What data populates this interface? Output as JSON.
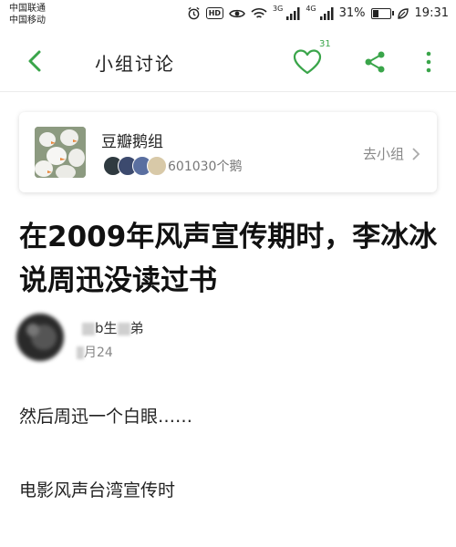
{
  "status_bar": {
    "carrier_1": "中国联通",
    "carrier_2": "中国移动",
    "network_labels": [
      "3G",
      "4G"
    ],
    "battery_text": "31%",
    "battery_level_percent": 31,
    "time": "19:31",
    "hd_label": "HD",
    "icons": [
      "alarm-icon",
      "hd-icon",
      "eye-icon",
      "wifi-icon",
      "signal-icon",
      "battery-icon",
      "leaf-icon"
    ]
  },
  "header": {
    "title": "小组讨论",
    "like_count": "31",
    "icons": [
      "back-icon",
      "heart-icon",
      "share-icon",
      "more-icon"
    ]
  },
  "group_card": {
    "name": "豆瓣鹅组",
    "member_count": "601030个鹅",
    "goto_label": "去小组"
  },
  "post": {
    "title": "在2009年风声宣传期时，李冰冰说周迅没读过书",
    "author_name_parts": [
      "b生",
      "弟"
    ],
    "date_visible": "月24",
    "paragraphs": [
      "然后周迅一个白眼……",
      "电影风声台湾宣传时"
    ]
  },
  "colors": {
    "accent_green": "#3aa54a",
    "text_primary": "#111111",
    "text_secondary": "#888888"
  }
}
